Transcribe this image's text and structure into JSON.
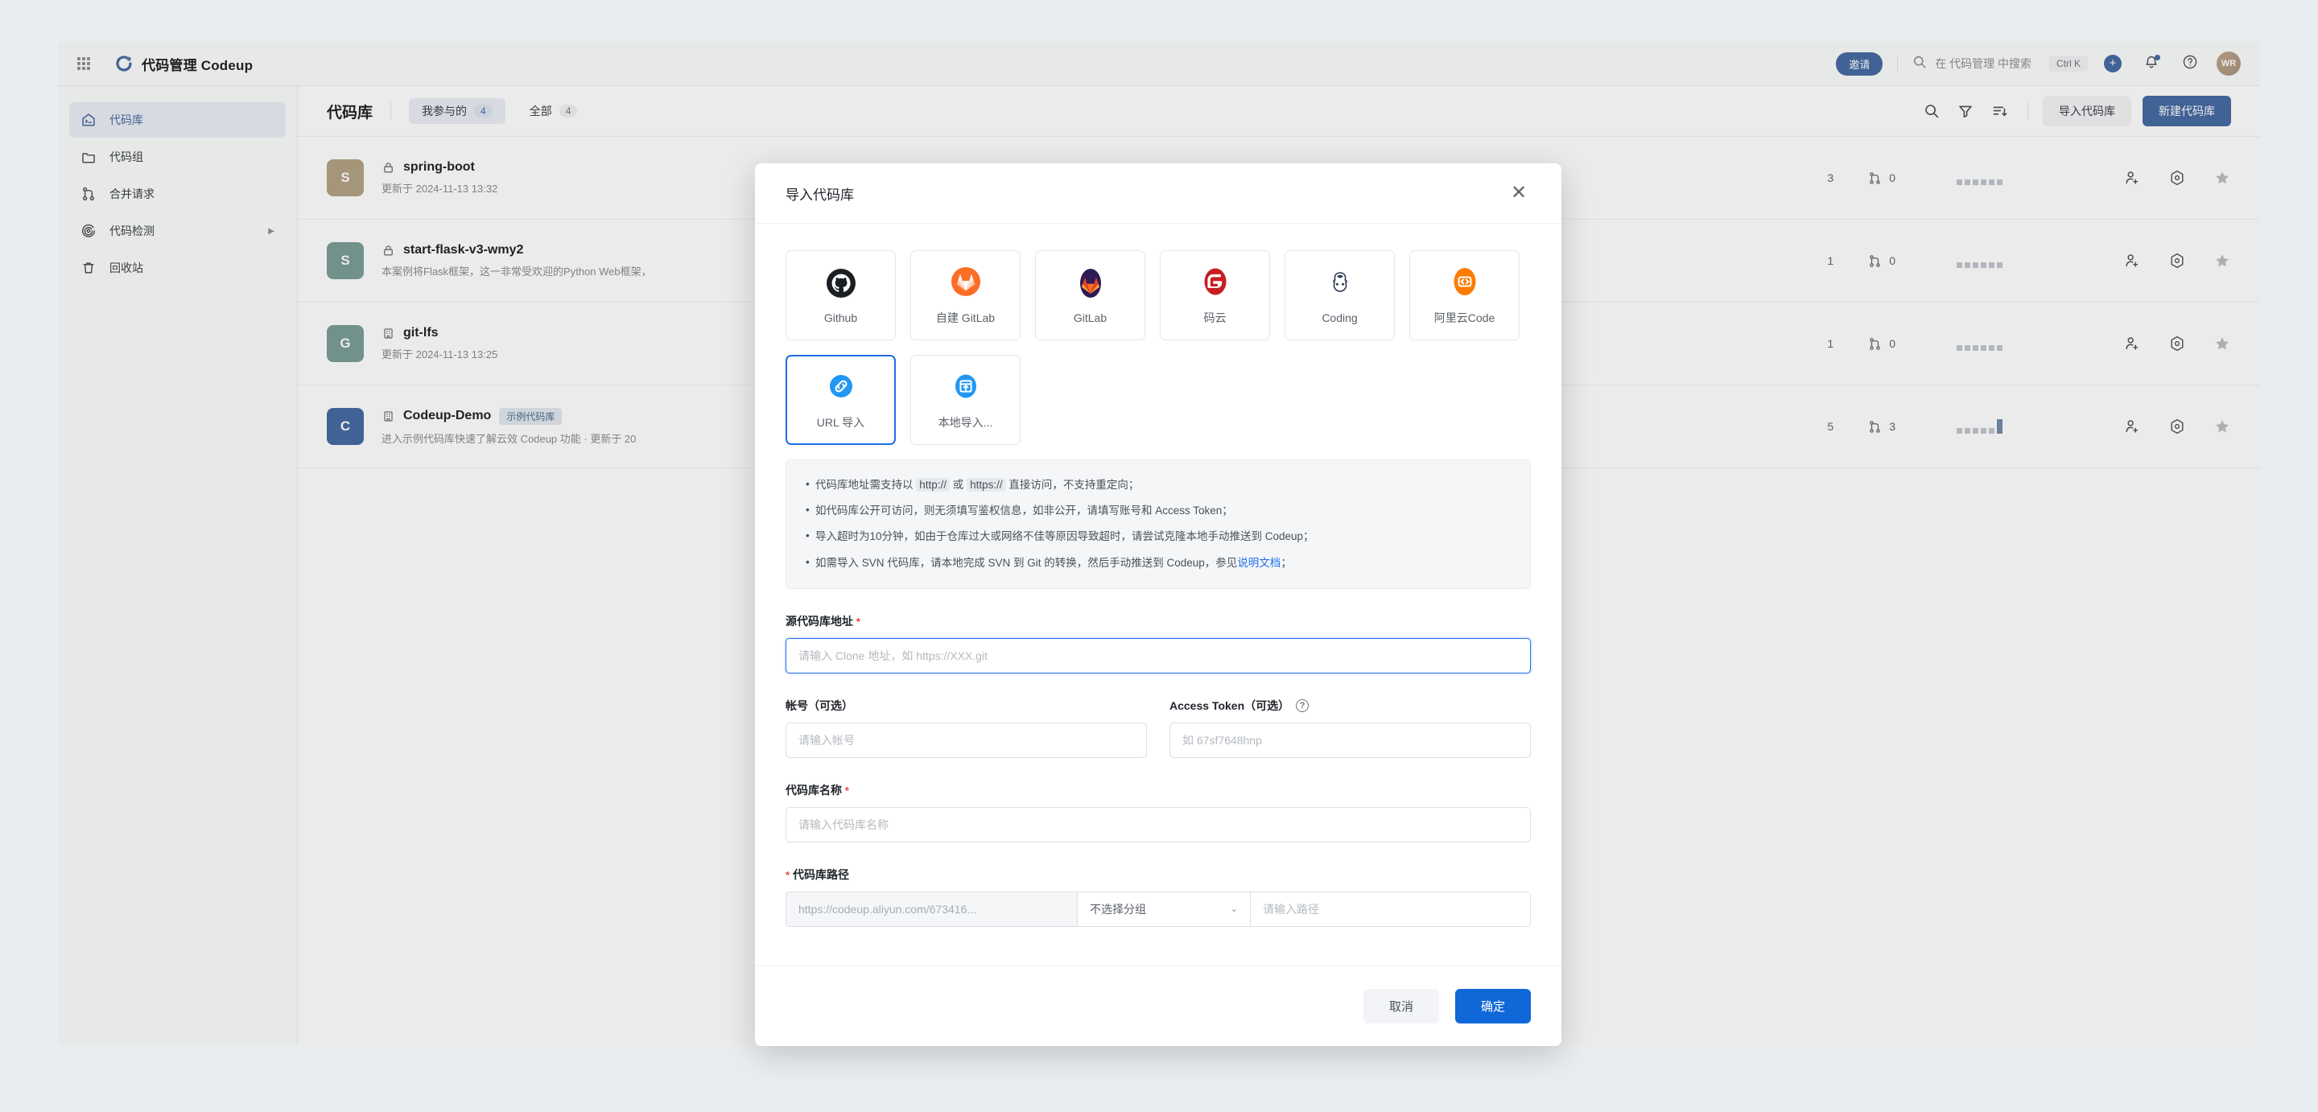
{
  "header": {
    "brand_title": "代码管理 Codeup",
    "brand_logo_icon": "codeup-logo-icon",
    "app_grid_icon": "app-grid-icon",
    "invite_label": "邀请",
    "search_icon": "search-icon",
    "search_placeholder": "在 代码管理 中搜索",
    "search_shortcut": "Ctrl K",
    "plus_icon": "plus-icon",
    "bell_icon": "bell-icon",
    "help_icon": "question-mark-icon",
    "avatar_initials": "WR"
  },
  "sidebar": {
    "items": [
      {
        "label": "代码库",
        "icon": "repository-icon",
        "active": true,
        "has_arrow": false
      },
      {
        "label": "代码组",
        "icon": "folder-icon",
        "active": false,
        "has_arrow": false
      },
      {
        "label": "合并请求",
        "icon": "merge-request-icon",
        "active": false,
        "has_arrow": false
      },
      {
        "label": "代码检测",
        "icon": "scan-icon",
        "active": false,
        "has_arrow": true,
        "arrow": "▶"
      },
      {
        "label": "回收站",
        "icon": "trash-icon",
        "active": false,
        "has_arrow": false
      }
    ]
  },
  "main": {
    "page_title": "代码库",
    "tabs": [
      {
        "label": "我参与的",
        "count": "4",
        "active": true
      },
      {
        "label": "全部",
        "count": "4",
        "active": false
      }
    ],
    "tools": {
      "search_icon": "search-icon",
      "filter_icon": "filter-icon",
      "sort_icon": "sort-icon",
      "import_label": "导入代码库",
      "new_label": "新建代码库"
    },
    "rows": [
      {
        "avatar_letter": "S",
        "avatar_color": "#c6a15b",
        "visibility_icon": "lock-icon",
        "name": "spring-boot",
        "badge": "",
        "desc": "更新于 2024-11-13 13:32",
        "stat_star": "3",
        "stat_mr": "0",
        "spark": [
          40,
          40,
          40,
          40,
          40,
          40
        ],
        "spark_hi": -1
      },
      {
        "avatar_letter": "S",
        "avatar_color": "#5aa79a",
        "visibility_icon": "lock-icon",
        "name": "start-flask-v3-wmy2",
        "badge": "",
        "desc": "本案例将Flask框架，这一非常受欢迎的Python Web框架，",
        "stat_star": "1",
        "stat_mr": "0",
        "spark": [
          40,
          40,
          40,
          40,
          40,
          40
        ],
        "spark_hi": -1
      },
      {
        "avatar_letter": "G",
        "avatar_color": "#5aa79a",
        "visibility_icon": "building-icon",
        "name": "git-lfs",
        "badge": "",
        "desc": "更新于 2024-11-13 13:25",
        "stat_star": "1",
        "stat_mr": "0",
        "spark": [
          40,
          40,
          40,
          40,
          40,
          40
        ],
        "spark_hi": -1
      },
      {
        "avatar_letter": "C",
        "avatar_color": "#1f6feb",
        "visibility_icon": "building-icon",
        "name": "Codeup-Demo",
        "badge": "示例代码库",
        "desc": "进入示例代码库快速了解云效 Codeup 功能 · 更新于 20",
        "stat_star": "5",
        "stat_mr": "3",
        "spark": [
          40,
          40,
          40,
          40,
          40,
          100
        ],
        "spark_hi": 5
      }
    ],
    "row_action_icons": [
      "add-member-icon",
      "settings-icon",
      "star-icon"
    ]
  },
  "modal": {
    "title": "导入代码库",
    "close_icon": "close-icon",
    "providers": [
      {
        "label": "Github",
        "icon": "github-icon",
        "selected": false
      },
      {
        "label": "自建 GitLab",
        "icon": "gitlab-fox-icon",
        "selected": false
      },
      {
        "label": "GitLab",
        "icon": "gitlab-icon",
        "selected": false
      },
      {
        "label": "码云",
        "icon": "gitee-icon",
        "selected": false
      },
      {
        "label": "Coding",
        "icon": "coding-icon",
        "selected": false
      },
      {
        "label": "阿里云Code",
        "icon": "aliyun-code-icon",
        "selected": false
      },
      {
        "label": "URL 导入",
        "icon": "link-icon",
        "selected": true
      },
      {
        "label": "本地导入...",
        "icon": "upload-icon",
        "selected": false
      }
    ],
    "notices": [
      {
        "pre": "代码库地址需支持以 ",
        "code1": "http://",
        "mid": " 或 ",
        "code2": "https://",
        "post": " 直接访问，不支持重定向；"
      },
      {
        "text": "如代码库公开可访问，则无须填写鉴权信息，如非公开，请填写账号和 Access Token；"
      },
      {
        "text": "导入超时为10分钟，如由于仓库过大或网络不佳等原因导致超时，请尝试克隆本地手动推送到 Codeup；"
      },
      {
        "pre2": "如需导入 SVN 代码库，请本地完成 SVN 到 Git 的转换，然后手动推送到 Codeup，参见",
        "link": "说明文档",
        "post2": "；"
      }
    ],
    "fields": {
      "source_url_label": "源代码库地址",
      "source_url_required": "*",
      "source_url_value": "",
      "source_url_placeholder": "请输入 Clone 地址，如 https://XXX.git",
      "account_label": "帐号（可选）",
      "account_value": "",
      "account_placeholder": "请输入帐号",
      "token_label": "Access Token（可选）",
      "token_help_icon": "question-mark-icon",
      "token_value": "",
      "token_placeholder": "如 67sf7648hnp",
      "repo_name_label": "代码库名称",
      "repo_name_required": "*",
      "repo_name_value": "",
      "repo_name_placeholder": "请输入代码库名称",
      "repo_path_label": "代码库路径",
      "repo_path_required": "*",
      "path_host": "https://codeup.aliyun.com/673416...",
      "path_group_value": "不选择分组",
      "path_group_chevron": "⌄",
      "path_value": "",
      "path_placeholder": "请输入路径"
    },
    "footer": {
      "cancel_label": "取消",
      "confirm_label": "确定"
    }
  },
  "colors": {
    "accent": "#1f6feb",
    "confirm": "#1068d8",
    "page_bg": "#e9edf0",
    "required": "#e8443a",
    "link": "#1f6feb"
  }
}
